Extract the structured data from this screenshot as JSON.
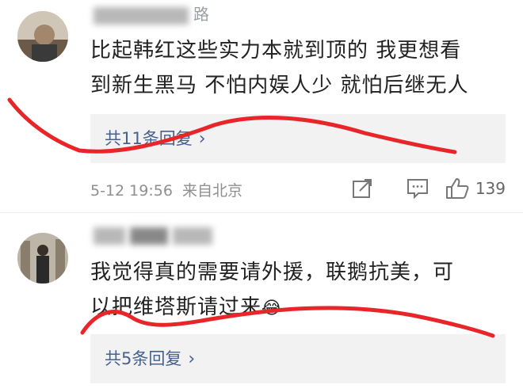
{
  "comments": [
    {
      "username_suffix": "路",
      "text_line1": "比起韩红这些实力本就到顶的 我更想看",
      "text_line2": "到新生黑马 不怕内娱人少 就怕后继无人",
      "replies_label": "共11条回复",
      "chevron": "›",
      "timestamp": "5-12 19:56",
      "source": "来自北京",
      "likes": "139",
      "icons": [
        "share-icon",
        "comment-icon",
        "like-icon"
      ]
    },
    {
      "username_suffix": "",
      "text_line1": "我觉得真的需要请外援，联鹅抗美，可",
      "text_line2": "以把维塔斯请过来",
      "emoji": "😂",
      "replies_label": "共5条回复",
      "chevron": "›"
    }
  ],
  "colors": {
    "link": "#46618e",
    "reply_bg": "#f2f2f2",
    "meta_text": "#8f8f8f",
    "annotation": "#e8262a"
  }
}
